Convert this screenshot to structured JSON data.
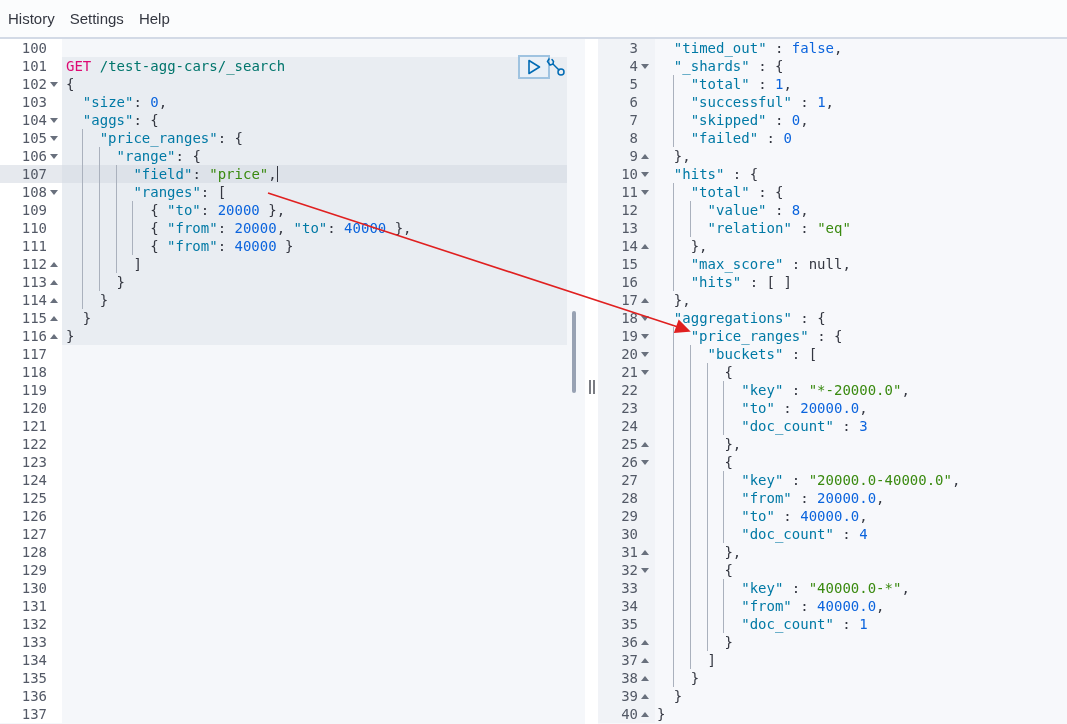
{
  "menu": [
    {
      "label": "History"
    },
    {
      "label": "Settings"
    },
    {
      "label": "Help"
    }
  ],
  "request_editor": {
    "lines": [
      {
        "no": "100",
        "fold_start": false,
        "fold_end": false,
        "request": false,
        "active": false
      },
      {
        "no": "101",
        "fold_start": false,
        "fold_end": false,
        "request": true,
        "active": false,
        "tokens": [
          {
            "kind": "method",
            "text": "GET"
          },
          {
            "kind": "url",
            "text": "/test-agg-cars/_search"
          }
        ]
      },
      {
        "no": "102",
        "fold_start": true,
        "fold_end": false,
        "request": true,
        "active": false,
        "tokens": [
          {
            "kind": "plain",
            "text": "{"
          }
        ]
      },
      {
        "no": "103",
        "fold_start": false,
        "fold_end": false,
        "request": true,
        "active": false,
        "tokens": [
          {
            "kind": "key",
            "text": "  \"size\""
          },
          {
            "kind": "plain",
            "text": ": "
          },
          {
            "kind": "number",
            "text": "0"
          },
          {
            "kind": "plain",
            "text": ","
          }
        ]
      },
      {
        "no": "104",
        "fold_start": true,
        "fold_end": false,
        "request": true,
        "active": false,
        "tokens": [
          {
            "kind": "key",
            "text": "  \"aggs\""
          },
          {
            "kind": "plain",
            "text": ": {"
          }
        ]
      },
      {
        "no": "105",
        "fold_start": true,
        "fold_end": false,
        "request": true,
        "active": false,
        "tokens": [
          {
            "kind": "key",
            "text": "    \"price_ranges\""
          },
          {
            "kind": "plain",
            "text": ": {"
          }
        ]
      },
      {
        "no": "106",
        "fold_start": true,
        "fold_end": false,
        "request": true,
        "active": false,
        "tokens": [
          {
            "kind": "key",
            "text": "      \"range\""
          },
          {
            "kind": "plain",
            "text": ": {"
          }
        ]
      },
      {
        "no": "107",
        "fold_start": false,
        "fold_end": false,
        "request": true,
        "active": true,
        "tokens": [
          {
            "kind": "key",
            "text": "        \"field\""
          },
          {
            "kind": "plain",
            "text": ": "
          },
          {
            "kind": "string",
            "text": "\"price\""
          },
          {
            "kind": "plain",
            "text": ","
          }
        ]
      },
      {
        "no": "108",
        "fold_start": true,
        "fold_end": false,
        "request": true,
        "active": false,
        "tokens": [
          {
            "kind": "key",
            "text": "        \"ranges\""
          },
          {
            "kind": "plain",
            "text": ": ["
          }
        ]
      },
      {
        "no": "109",
        "fold_start": false,
        "fold_end": false,
        "request": true,
        "active": false,
        "tokens": [
          {
            "kind": "plain",
            "text": "          { "
          },
          {
            "kind": "key",
            "text": "\"to\""
          },
          {
            "kind": "plain",
            "text": ": "
          },
          {
            "kind": "number",
            "text": "20000"
          },
          {
            "kind": "plain",
            "text": " },"
          }
        ]
      },
      {
        "no": "110",
        "fold_start": false,
        "fold_end": false,
        "request": true,
        "active": false,
        "tokens": [
          {
            "kind": "plain",
            "text": "          { "
          },
          {
            "kind": "key",
            "text": "\"from\""
          },
          {
            "kind": "plain",
            "text": ": "
          },
          {
            "kind": "number",
            "text": "20000"
          },
          {
            "kind": "plain",
            "text": ", "
          },
          {
            "kind": "key",
            "text": "\"to\""
          },
          {
            "kind": "plain",
            "text": ": "
          },
          {
            "kind": "number",
            "text": "40000"
          },
          {
            "kind": "plain",
            "text": " },"
          }
        ]
      },
      {
        "no": "111",
        "fold_start": false,
        "fold_end": false,
        "request": true,
        "active": false,
        "tokens": [
          {
            "kind": "plain",
            "text": "          { "
          },
          {
            "kind": "key",
            "text": "\"from\""
          },
          {
            "kind": "plain",
            "text": ": "
          },
          {
            "kind": "number",
            "text": "40000"
          },
          {
            "kind": "plain",
            "text": " }"
          }
        ]
      },
      {
        "no": "112",
        "fold_start": false,
        "fold_end": true,
        "request": true,
        "active": false,
        "tokens": [
          {
            "kind": "plain",
            "text": "        ]"
          }
        ]
      },
      {
        "no": "113",
        "fold_start": false,
        "fold_end": true,
        "request": true,
        "active": false,
        "tokens": [
          {
            "kind": "plain",
            "text": "      }"
          }
        ]
      },
      {
        "no": "114",
        "fold_start": false,
        "fold_end": true,
        "request": true,
        "active": false,
        "tokens": [
          {
            "kind": "plain",
            "text": "    }"
          }
        ]
      },
      {
        "no": "115",
        "fold_start": false,
        "fold_end": true,
        "request": true,
        "active": false,
        "tokens": [
          {
            "kind": "plain",
            "text": "  }"
          }
        ]
      },
      {
        "no": "116",
        "fold_start": false,
        "fold_end": true,
        "request": true,
        "active": false,
        "tokens": [
          {
            "kind": "plain",
            "text": "}"
          }
        ]
      },
      {
        "no": "117",
        "fold_start": false,
        "fold_end": false,
        "request": false,
        "active": false
      },
      {
        "no": "118",
        "fold_start": false,
        "fold_end": false,
        "request": false,
        "active": false
      },
      {
        "no": "119",
        "fold_start": false,
        "fold_end": false,
        "request": false,
        "active": false
      },
      {
        "no": "120",
        "fold_start": false,
        "fold_end": false,
        "request": false,
        "active": false
      },
      {
        "no": "121",
        "fold_start": false,
        "fold_end": false,
        "request": false,
        "active": false
      },
      {
        "no": "122",
        "fold_start": false,
        "fold_end": false,
        "request": false,
        "active": false
      },
      {
        "no": "123",
        "fold_start": false,
        "fold_end": false,
        "request": false,
        "active": false
      },
      {
        "no": "124",
        "fold_start": false,
        "fold_end": false,
        "request": false,
        "active": false
      },
      {
        "no": "125",
        "fold_start": false,
        "fold_end": false,
        "request": false,
        "active": false
      },
      {
        "no": "126",
        "fold_start": false,
        "fold_end": false,
        "request": false,
        "active": false
      },
      {
        "no": "127",
        "fold_start": false,
        "fold_end": false,
        "request": false,
        "active": false
      },
      {
        "no": "128",
        "fold_start": false,
        "fold_end": false,
        "request": false,
        "active": false
      },
      {
        "no": "129",
        "fold_start": false,
        "fold_end": false,
        "request": false,
        "active": false
      },
      {
        "no": "130",
        "fold_start": false,
        "fold_end": false,
        "request": false,
        "active": false
      },
      {
        "no": "131",
        "fold_start": false,
        "fold_end": false,
        "request": false,
        "active": false
      },
      {
        "no": "132",
        "fold_start": false,
        "fold_end": false,
        "request": false,
        "active": false
      },
      {
        "no": "133",
        "fold_start": false,
        "fold_end": false,
        "request": false,
        "active": false
      },
      {
        "no": "134",
        "fold_start": false,
        "fold_end": false,
        "request": false,
        "active": false
      },
      {
        "no": "135",
        "fold_start": false,
        "fold_end": false,
        "request": false,
        "active": false
      },
      {
        "no": "136",
        "fold_start": false,
        "fold_end": false,
        "request": false,
        "active": false
      },
      {
        "no": "137",
        "fold_start": false,
        "fold_end": false,
        "request": false,
        "active": false
      }
    ]
  },
  "response_viewer": {
    "lines": [
      {
        "no": "3",
        "fold_start": false,
        "fold_end": false,
        "tokens": [
          {
            "kind": "key",
            "text": "  \"timed_out\""
          },
          {
            "kind": "plain",
            "text": " : "
          },
          {
            "kind": "literal",
            "text": "false"
          },
          {
            "kind": "plain",
            "text": ","
          }
        ]
      },
      {
        "no": "4",
        "fold_start": true,
        "fold_end": false,
        "tokens": [
          {
            "kind": "key",
            "text": "  \"_shards\""
          },
          {
            "kind": "plain",
            "text": " : {"
          }
        ]
      },
      {
        "no": "5",
        "fold_start": false,
        "fold_end": false,
        "tokens": [
          {
            "kind": "key",
            "text": "    \"total\""
          },
          {
            "kind": "plain",
            "text": " : "
          },
          {
            "kind": "number",
            "text": "1"
          },
          {
            "kind": "plain",
            "text": ","
          }
        ]
      },
      {
        "no": "6",
        "fold_start": false,
        "fold_end": false,
        "tokens": [
          {
            "kind": "key",
            "text": "    \"successful\""
          },
          {
            "kind": "plain",
            "text": " : "
          },
          {
            "kind": "number",
            "text": "1"
          },
          {
            "kind": "plain",
            "text": ","
          }
        ]
      },
      {
        "no": "7",
        "fold_start": false,
        "fold_end": false,
        "tokens": [
          {
            "kind": "key",
            "text": "    \"skipped\""
          },
          {
            "kind": "plain",
            "text": " : "
          },
          {
            "kind": "number",
            "text": "0"
          },
          {
            "kind": "plain",
            "text": ","
          }
        ]
      },
      {
        "no": "8",
        "fold_start": false,
        "fold_end": false,
        "tokens": [
          {
            "kind": "key",
            "text": "    \"failed\""
          },
          {
            "kind": "plain",
            "text": " : "
          },
          {
            "kind": "number",
            "text": "0"
          }
        ]
      },
      {
        "no": "9",
        "fold_start": false,
        "fold_end": true,
        "tokens": [
          {
            "kind": "plain",
            "text": "  },"
          }
        ]
      },
      {
        "no": "10",
        "fold_start": true,
        "fold_end": false,
        "tokens": [
          {
            "kind": "key",
            "text": "  \"hits\""
          },
          {
            "kind": "plain",
            "text": " : {"
          }
        ]
      },
      {
        "no": "11",
        "fold_start": true,
        "fold_end": false,
        "tokens": [
          {
            "kind": "key",
            "text": "    \"total\""
          },
          {
            "kind": "plain",
            "text": " : {"
          }
        ]
      },
      {
        "no": "12",
        "fold_start": false,
        "fold_end": false,
        "tokens": [
          {
            "kind": "key",
            "text": "      \"value\""
          },
          {
            "kind": "plain",
            "text": " : "
          },
          {
            "kind": "number",
            "text": "8"
          },
          {
            "kind": "plain",
            "text": ","
          }
        ]
      },
      {
        "no": "13",
        "fold_start": false,
        "fold_end": false,
        "tokens": [
          {
            "kind": "key",
            "text": "      \"relation\""
          },
          {
            "kind": "plain",
            "text": " : "
          },
          {
            "kind": "string",
            "text": "\"eq\""
          }
        ]
      },
      {
        "no": "14",
        "fold_start": false,
        "fold_end": true,
        "tokens": [
          {
            "kind": "plain",
            "text": "    },"
          }
        ]
      },
      {
        "no": "15",
        "fold_start": false,
        "fold_end": false,
        "tokens": [
          {
            "kind": "key",
            "text": "    \"max_score\""
          },
          {
            "kind": "plain",
            "text": " : null,"
          }
        ]
      },
      {
        "no": "16",
        "fold_start": false,
        "fold_end": false,
        "tokens": [
          {
            "kind": "key",
            "text": "    \"hits\""
          },
          {
            "kind": "plain",
            "text": " : [ ]"
          }
        ]
      },
      {
        "no": "17",
        "fold_start": false,
        "fold_end": true,
        "tokens": [
          {
            "kind": "plain",
            "text": "  },"
          }
        ]
      },
      {
        "no": "18",
        "fold_start": true,
        "fold_end": false,
        "tokens": [
          {
            "kind": "key",
            "text": "  \"aggregations\""
          },
          {
            "kind": "plain",
            "text": " : {"
          }
        ]
      },
      {
        "no": "19",
        "fold_start": true,
        "fold_end": false,
        "tokens": [
          {
            "kind": "key",
            "text": "    \"price_ranges\""
          },
          {
            "kind": "plain",
            "text": " : {"
          }
        ]
      },
      {
        "no": "20",
        "fold_start": true,
        "fold_end": false,
        "tokens": [
          {
            "kind": "key",
            "text": "      \"buckets\""
          },
          {
            "kind": "plain",
            "text": " : ["
          }
        ]
      },
      {
        "no": "21",
        "fold_start": true,
        "fold_end": false,
        "tokens": [
          {
            "kind": "plain",
            "text": "        {"
          }
        ]
      },
      {
        "no": "22",
        "fold_start": false,
        "fold_end": false,
        "tokens": [
          {
            "kind": "key",
            "text": "          \"key\""
          },
          {
            "kind": "plain",
            "text": " : "
          },
          {
            "kind": "string",
            "text": "\"*-20000.0\""
          },
          {
            "kind": "plain",
            "text": ","
          }
        ]
      },
      {
        "no": "23",
        "fold_start": false,
        "fold_end": false,
        "tokens": [
          {
            "kind": "key",
            "text": "          \"to\""
          },
          {
            "kind": "plain",
            "text": " : "
          },
          {
            "kind": "number",
            "text": "20000.0"
          },
          {
            "kind": "plain",
            "text": ","
          }
        ]
      },
      {
        "no": "24",
        "fold_start": false,
        "fold_end": false,
        "tokens": [
          {
            "kind": "key",
            "text": "          \"doc_count\""
          },
          {
            "kind": "plain",
            "text": " : "
          },
          {
            "kind": "number",
            "text": "3"
          }
        ]
      },
      {
        "no": "25",
        "fold_start": false,
        "fold_end": true,
        "tokens": [
          {
            "kind": "plain",
            "text": "        },"
          }
        ]
      },
      {
        "no": "26",
        "fold_start": true,
        "fold_end": false,
        "tokens": [
          {
            "kind": "plain",
            "text": "        {"
          }
        ]
      },
      {
        "no": "27",
        "fold_start": false,
        "fold_end": false,
        "tokens": [
          {
            "kind": "key",
            "text": "          \"key\""
          },
          {
            "kind": "plain",
            "text": " : "
          },
          {
            "kind": "string",
            "text": "\"20000.0-40000.0\""
          },
          {
            "kind": "plain",
            "text": ","
          }
        ]
      },
      {
        "no": "28",
        "fold_start": false,
        "fold_end": false,
        "tokens": [
          {
            "kind": "key",
            "text": "          \"from\""
          },
          {
            "kind": "plain",
            "text": " : "
          },
          {
            "kind": "number",
            "text": "20000.0"
          },
          {
            "kind": "plain",
            "text": ","
          }
        ]
      },
      {
        "no": "29",
        "fold_start": false,
        "fold_end": false,
        "tokens": [
          {
            "kind": "key",
            "text": "          \"to\""
          },
          {
            "kind": "plain",
            "text": " : "
          },
          {
            "kind": "number",
            "text": "40000.0"
          },
          {
            "kind": "plain",
            "text": ","
          }
        ]
      },
      {
        "no": "30",
        "fold_start": false,
        "fold_end": false,
        "tokens": [
          {
            "kind": "key",
            "text": "          \"doc_count\""
          },
          {
            "kind": "plain",
            "text": " : "
          },
          {
            "kind": "number",
            "text": "4"
          }
        ]
      },
      {
        "no": "31",
        "fold_start": false,
        "fold_end": true,
        "tokens": [
          {
            "kind": "plain",
            "text": "        },"
          }
        ]
      },
      {
        "no": "32",
        "fold_start": true,
        "fold_end": false,
        "tokens": [
          {
            "kind": "plain",
            "text": "        {"
          }
        ]
      },
      {
        "no": "33",
        "fold_start": false,
        "fold_end": false,
        "tokens": [
          {
            "kind": "key",
            "text": "          \"key\""
          },
          {
            "kind": "plain",
            "text": " : "
          },
          {
            "kind": "string",
            "text": "\"40000.0-*\""
          },
          {
            "kind": "plain",
            "text": ","
          }
        ]
      },
      {
        "no": "34",
        "fold_start": false,
        "fold_end": false,
        "tokens": [
          {
            "kind": "key",
            "text": "          \"from\""
          },
          {
            "kind": "plain",
            "text": " : "
          },
          {
            "kind": "number",
            "text": "40000.0"
          },
          {
            "kind": "plain",
            "text": ","
          }
        ]
      },
      {
        "no": "35",
        "fold_start": false,
        "fold_end": false,
        "tokens": [
          {
            "kind": "key",
            "text": "          \"doc_count\""
          },
          {
            "kind": "plain",
            "text": " : "
          },
          {
            "kind": "number",
            "text": "1"
          }
        ]
      },
      {
        "no": "36",
        "fold_start": false,
        "fold_end": true,
        "tokens": [
          {
            "kind": "plain",
            "text": "        }"
          }
        ]
      },
      {
        "no": "37",
        "fold_start": false,
        "fold_end": true,
        "tokens": [
          {
            "kind": "plain",
            "text": "      ]"
          }
        ]
      },
      {
        "no": "38",
        "fold_start": false,
        "fold_end": true,
        "tokens": [
          {
            "kind": "plain",
            "text": "    }"
          }
        ]
      },
      {
        "no": "39",
        "fold_start": false,
        "fold_end": true,
        "tokens": [
          {
            "kind": "plain",
            "text": "  }"
          }
        ]
      },
      {
        "no": "40",
        "fold_start": false,
        "fold_end": true,
        "tokens": [
          {
            "kind": "plain",
            "text": "}"
          }
        ]
      }
    ]
  }
}
